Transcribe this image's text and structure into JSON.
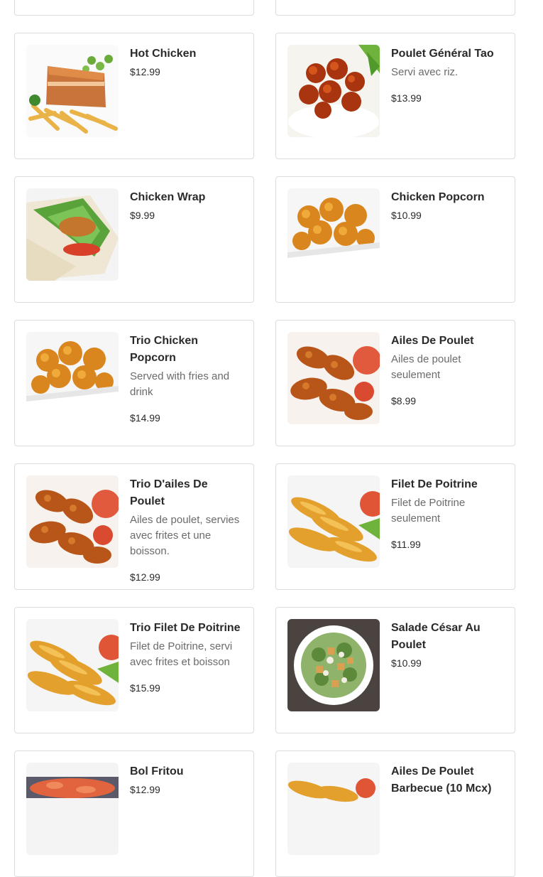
{
  "items": [
    {
      "name": "",
      "desc": "",
      "price": "",
      "img": "bowl-icon"
    },
    {
      "name": "",
      "desc": "",
      "price": "",
      "img": "fries-icon"
    },
    {
      "name": "Hot Chicken",
      "desc": "",
      "price": "$12.99",
      "img": "hot-chicken-icon"
    },
    {
      "name": "Poulet Général Tao",
      "desc": "Servi avec riz.",
      "price": "$13.99",
      "img": "general-tao-icon"
    },
    {
      "name": "Chicken Wrap",
      "desc": "",
      "price": "$9.99",
      "img": "wrap-icon"
    },
    {
      "name": "Chicken Popcorn",
      "desc": "",
      "price": "$10.99",
      "img": "popcorn-icon"
    },
    {
      "name": "Trio Chicken Popcorn",
      "desc": "Served with fries and drink",
      "price": "$14.99",
      "img": "popcorn-icon"
    },
    {
      "name": "Ailes De Poulet",
      "desc": "Ailes de poulet seulement",
      "price": "$8.99",
      "img": "wings-icon"
    },
    {
      "name": "Trio D'ailes De Poulet",
      "desc": "Ailes de poulet, servies avec frites et une boisson.",
      "price": "$12.99",
      "img": "wings-icon"
    },
    {
      "name": "Filet De Poitrine",
      "desc": "Filet de Poitrine seulement",
      "price": "$11.99",
      "img": "tenders-icon"
    },
    {
      "name": "Trio Filet De Poitrine",
      "desc": "Filet de Poitrine, servi avec frites et boisson",
      "price": "$15.99",
      "img": "tenders-icon"
    },
    {
      "name": "Salade César Au Poulet",
      "desc": "",
      "price": "$10.99",
      "img": "salad-icon"
    },
    {
      "name": "Bol Fritou",
      "desc": "",
      "price": "$12.99",
      "img": "bowl-icon"
    },
    {
      "name": "Ailes De Poulet Barbecue (10 Mcx)",
      "desc": "",
      "price": "",
      "img": "tenders-icon"
    }
  ]
}
